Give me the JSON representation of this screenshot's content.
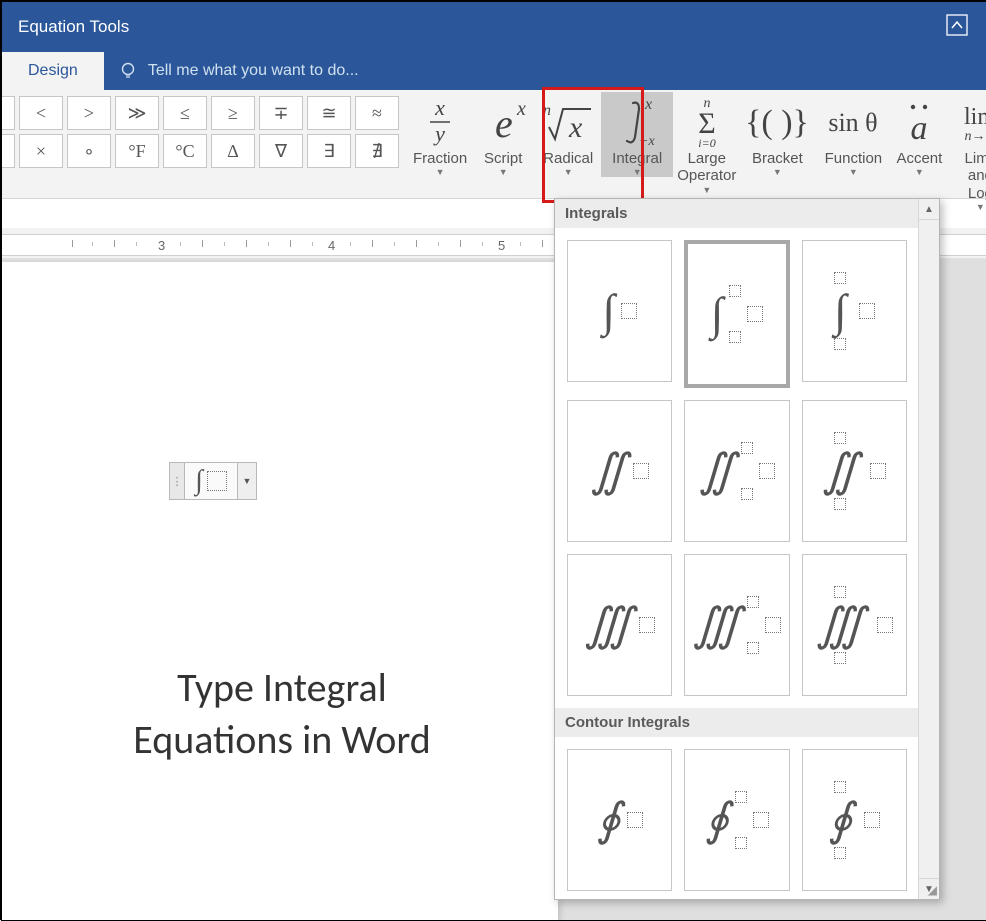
{
  "titlebar": {
    "title": "Equation Tools"
  },
  "tabs": {
    "design": "Design"
  },
  "tellme": {
    "placeholder": "Tell me what you want to do..."
  },
  "symbols": {
    "row1": [
      "<",
      ">",
      "≫",
      "≤",
      "≥",
      "∓",
      "≅",
      "≈"
    ],
    "row2": [
      "×",
      "∘",
      "°F",
      "°C",
      "∆",
      "∇",
      "∃",
      "∄"
    ]
  },
  "structures": {
    "fraction": "Fraction",
    "script": "Script",
    "radical": "Radical",
    "integral": "Integral",
    "large_operator": "Large\nOperator",
    "bracket": "Bracket",
    "function": "Function",
    "accent": "Accent",
    "limit_log": "Limit and\nLog"
  },
  "ruler": {
    "marks": [
      "3",
      "4",
      "5"
    ]
  },
  "document": {
    "title_line1": "Type Integral",
    "title_line2": "Equations in Word"
  },
  "gallery": {
    "section1": "Integrals",
    "section2": "Contour Integrals"
  }
}
